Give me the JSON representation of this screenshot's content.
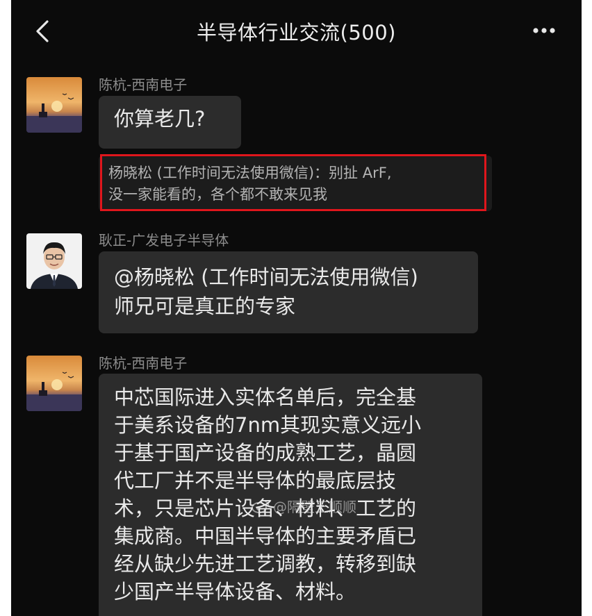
{
  "header": {
    "title": "半导体行业交流(500)"
  },
  "messages": [
    {
      "sender": "陈杭-西南电子",
      "avatar": "sunset-avatar",
      "text_lines": [
        "你算老几?"
      ],
      "quote_lines": [
        "杨晓松 (工作时间无法使用微信)：别扯 ArF,",
        "没一家能看的，各个都不敢来见我"
      ]
    },
    {
      "sender": "耿正-广发电子半导体",
      "avatar": "person-avatar",
      "text_lines": [
        "@杨晓松 (工作时间无法使用微信)",
        "师兄可是真正的专家"
      ]
    },
    {
      "sender": "陈杭-西南电子",
      "avatar": "sunset-avatar",
      "text_lines": [
        "中芯国际进入实体名单后，完全基",
        "于美系设备的7nm其现实意义远小",
        "于基于国产设备的成熟工艺，晶圆",
        "代工厂并不是半导体的最底层技",
        "术，只是芯片设备、材料、工艺的",
        "集成商。中国半导体的主要矛盾已",
        "经从缺少先进工艺调教，转移到缺",
        "少国产半导体设备、材料。"
      ]
    }
  ],
  "watermark": {
    "text": "@隔壁王顺顺"
  },
  "colors": {
    "background": "#0b0b0b",
    "bubble": "#2c2c2c",
    "highlight": "#e0161c"
  }
}
